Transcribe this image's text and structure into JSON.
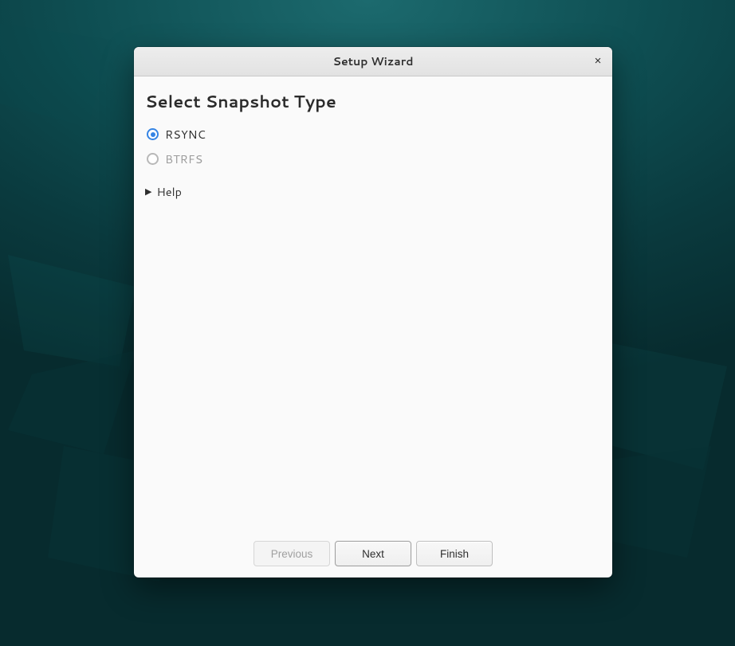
{
  "window": {
    "title": "Setup Wizard",
    "close_label": "×"
  },
  "content": {
    "heading": "Select Snapshot Type",
    "options": [
      {
        "label": "RSYNC",
        "selected": true,
        "enabled": true
      },
      {
        "label": "BTRFS",
        "selected": false,
        "enabled": false
      }
    ],
    "help_label": "Help",
    "help_expanded": false
  },
  "buttons": {
    "previous": {
      "label": "Previous",
      "enabled": false
    },
    "next": {
      "label": "Next",
      "enabled": true
    },
    "finish": {
      "label": "Finish",
      "enabled": true
    }
  }
}
